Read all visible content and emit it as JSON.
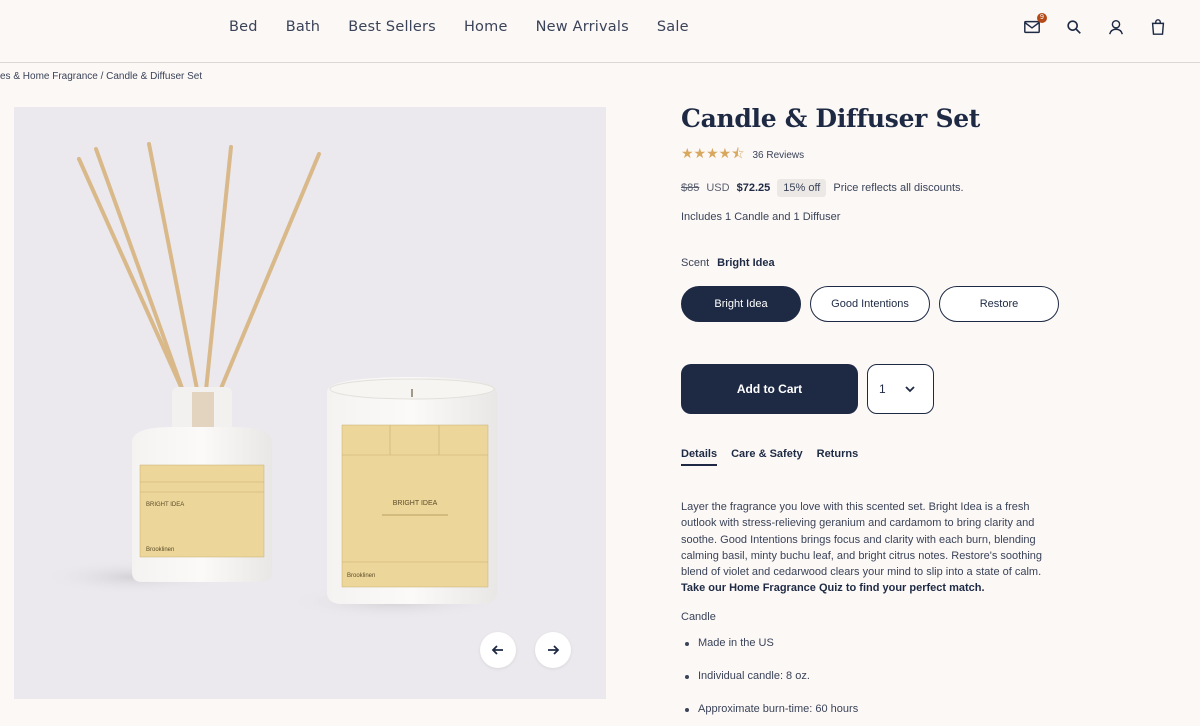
{
  "nav": {
    "items": [
      "Bed",
      "Bath",
      "Best Sellers",
      "Home",
      "New Arrivals",
      "Sale"
    ]
  },
  "header_icons": {
    "mail": "mail-icon",
    "mail_badge": "9",
    "search": "search-icon",
    "account": "account-icon",
    "bag": "bag-icon"
  },
  "breadcrumb": "es & Home Fragrance / Candle & Diffuser Set",
  "product": {
    "title": "Candle & Diffuser Set",
    "rating": 4.5,
    "stars": "★★★★⯪",
    "reviews": "36 Reviews",
    "old_price": "$85",
    "old_price_unit": "USD",
    "new_price": "$72.25",
    "discount": "15% off",
    "price_note": "Price reflects all discounts.",
    "includes": "Includes 1 Candle and 1 Diffuser",
    "scent_label": "Scent",
    "scent_selected": "Bright Idea",
    "scent_options": [
      "Bright Idea",
      "Good Intentions",
      "Restore"
    ],
    "add_to_cart": "Add to Cart",
    "quantity": "1",
    "tabs": [
      "Details",
      "Care & Safety",
      "Returns"
    ],
    "description": "Layer the fragrance you love with this scented set. Bright Idea is a fresh outlook with stress-relieving geranium and cardamom to bring clarity and soothe. Good Intentions brings focus and clarity with each burn, blending calming basil, minty buchu leaf, and bright citrus notes. Restore's soothing blend of violet and cedarwood clears your mind to slip into a state of calm.",
    "description_cta": "Take our Home Fragrance Quiz to find your perfect match.",
    "candle_label": "Candle",
    "bullets": [
      "Made in the US",
      "Individual candle: 8 oz.",
      "Approximate burn-time: 60 hours"
    ]
  },
  "image_labels": {
    "diffuser_label": "BRIGHT IDEA",
    "candle_label": "BRIGHT IDEA",
    "brand": "Brooklinen"
  },
  "colors": {
    "navy": "#1e2a44",
    "background": "#fcf8f6",
    "image_bg": "#ebe9ed",
    "star": "#d9a85f",
    "badge": "#b34a18"
  }
}
